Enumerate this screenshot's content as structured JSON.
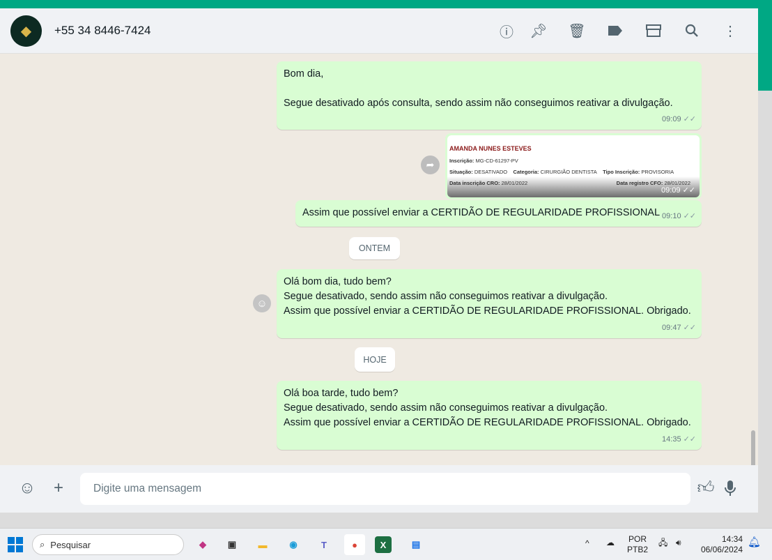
{
  "header": {
    "contact": "+55 34 8446-7424",
    "icons": [
      "info-icon",
      "pin-icon",
      "delete-icon",
      "label-icon",
      "store-icon",
      "search-icon",
      "menu-icon"
    ]
  },
  "messages": [
    {
      "lines": [
        "Bom dia,",
        "",
        "Segue desativado após consulta, sendo assim não conseguimos reativar a divulgação."
      ],
      "time": "09:09"
    },
    {
      "image": {
        "name": "AMANDA NUNES ESTEVES",
        "inscricao_label": "Inscrição:",
        "inscricao": "MG-CD-61297-PV",
        "situacao_label": "Situação:",
        "situacao": "DESATIVADO",
        "categoria_label": "Categoria:",
        "categoria": "CIRURGIÃO DENTISTA",
        "tipo_label": "Tipo Inscrição:",
        "tipo": "PROVISORIA",
        "data_cro_label": "Data inscrição CRO:",
        "data_cro": "28/01/2022",
        "data_cfo_label": "Data registro CFO:",
        "data_cfo": "28/01/2022"
      },
      "time": "09:09"
    },
    {
      "lines": [
        "Assim que possível enviar a CERTIDÃO DE REGULARIDADE PROFISSIONAL"
      ],
      "time": "09:10"
    },
    {
      "lines": [
        "Olá bom dia, tudo bem?",
        "Segue desativado, sendo assim não conseguimos reativar a divulgação.",
        "Assim que possível enviar a CERTIDÃO DE REGULARIDADE PROFISSIONAL. Obrigado."
      ],
      "time": "09:47"
    },
    {
      "lines": [
        "Olá boa tarde, tudo bem?",
        "Segue desativado, sendo assim não conseguimos reativar a divulgação.",
        "Assim que possível enviar a CERTIDÃO DE REGULARIDADE PROFISSIONAL. Obrigado."
      ],
      "time": "14:35"
    }
  ],
  "dividers": {
    "yesterday": "ONTEM",
    "today": "HOJE"
  },
  "composer": {
    "placeholder": "Digite uma mensagem"
  },
  "taskbar": {
    "search": "Pesquisar",
    "lang1": "POR",
    "lang2": "PTB2",
    "time": "14:34",
    "date": "06/06/2024",
    "apps": [
      "copilot",
      "task-view",
      "file-explorer",
      "edge",
      "teams",
      "chrome",
      "excel",
      "notepad"
    ]
  },
  "colors": {
    "accent": "#00a884",
    "bubble": "#d9fdd3",
    "chat_bg": "#efeae2"
  }
}
